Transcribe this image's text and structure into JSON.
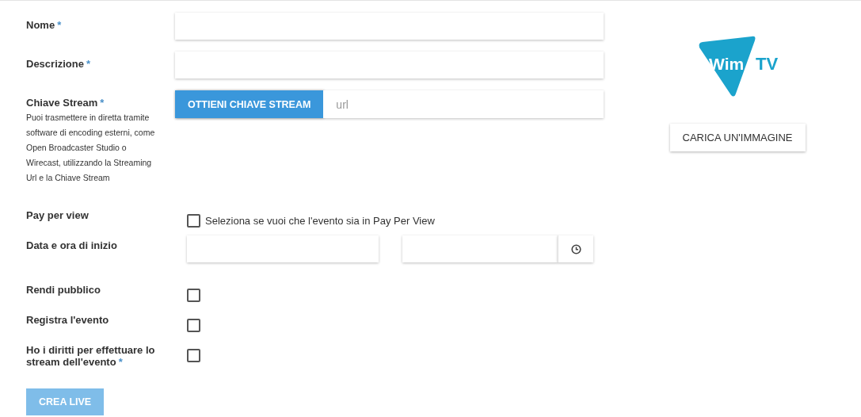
{
  "form": {
    "fields": [
      {
        "kind": "text",
        "label": "Nome",
        "required_mark": "*"
      },
      {
        "kind": "text",
        "label": "Descrizione",
        "required_mark": "*"
      },
      {
        "kind": "stream",
        "label": "Chiave Stream",
        "required_mark": "*",
        "help": "Puoi trasmettere in diretta tramite software di encoding esterni, come Open Broadcaster Studio o Wirecast, utilizzando la Streaming Url e la Chiave Stream",
        "button": "OTTIENI CHIAVE STREAM",
        "placeholder": "url"
      },
      {
        "kind": "checkbox",
        "label": "Pay per view",
        "checked": false,
        "checkbox_label": "Seleziona se vuoi che l'evento sia in Pay Per View"
      },
      {
        "kind": "datetime",
        "label": "Data e ora di inizio"
      },
      {
        "kind": "checkbox",
        "label": "Rendi pubblico",
        "checked": false
      },
      {
        "kind": "checkbox",
        "label": "Registra l'evento",
        "checked": false
      },
      {
        "kind": "checkbox",
        "label": "Ho i diritti per effettuare lo stream dell'evento",
        "required_mark": "*",
        "checked": false
      }
    ],
    "submit": {
      "label": "CREA LIVE",
      "disabled": true
    }
  },
  "logo": {
    "text_1": "Wim",
    "text_2": "TV"
  },
  "upload_button": "CARICA UN'IMMAGINE"
}
